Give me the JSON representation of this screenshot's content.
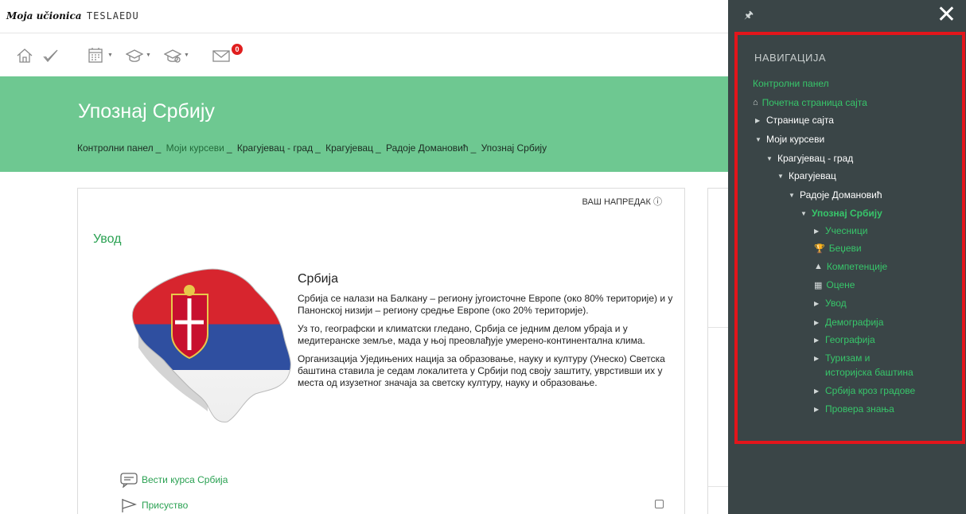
{
  "header": {
    "logo_script": "Moja učionica",
    "logo_brand": "TESLAEDU",
    "messages_count": "0"
  },
  "banner": {
    "title": "Упознај Србију",
    "breadcrumbs": [
      "Контролни панел",
      "Моји курсеви",
      "Крагујевац - град",
      "Крагујевац",
      "Радоје Домановић",
      "Упознај Србију"
    ],
    "separator": "_"
  },
  "main": {
    "progress_label": "ВАШ НАПРЕДАК",
    "progress_icon": "help-circle-icon",
    "section_title": "Увод",
    "article_title": "Србија",
    "paragraphs": [
      "Србија се налази на Балкану – региону југоисточне Европе (око 80% територије) и у Панонској низији – региону средње Европе (око 20% територије).",
      "Уз то, географски и климатски гледано, Србија се једним делом убраја и у медитеранске земље, мада у њој преовлађује умерено-континентална клима.",
      "Организација Уједињених нација за образовање, науку и културу (Унеско) Светска баштина ставила је седам локалитета у Србији под своју заштиту, уврстивши их у места од изузетног значаја за светску културу, науку и образовање."
    ],
    "activities": [
      {
        "label": "Вести курса Србија",
        "icon": "forum-icon"
      },
      {
        "label": "Присуство",
        "icon": "flag-icon"
      }
    ]
  },
  "drawer": {
    "title": "НАВИГАЦИЈА",
    "items": [
      {
        "label": "Контролни панел"
      },
      {
        "label": "Почетна страница сајта",
        "icon": "home-icon"
      },
      {
        "label": "Странице сајта"
      },
      {
        "label": "Моји курсеви"
      },
      {
        "label": "Крагујевац - град"
      },
      {
        "label": "Крагујевац"
      },
      {
        "label": "Радоје Домановић"
      },
      {
        "label": "Упознај Србију"
      },
      {
        "label": "Учесници"
      },
      {
        "label": "Беџеви",
        "icon": "trophy-icon"
      },
      {
        "label": "Компетенције",
        "icon": "pyramid-icon"
      },
      {
        "label": "Оцене",
        "icon": "table-icon"
      },
      {
        "label": "Увод"
      },
      {
        "label": "Демографија"
      },
      {
        "label": "Географија"
      },
      {
        "label": "Туризам и"
      },
      {
        "label": "историјска баштина"
      },
      {
        "label": "Србија кроз градове"
      },
      {
        "label": "Провера знања"
      }
    ]
  },
  "colors": {
    "banner": "#6ec891",
    "drawer": "#3a4547",
    "link_green": "#37c66a",
    "highlight_red": "#e3151b"
  }
}
